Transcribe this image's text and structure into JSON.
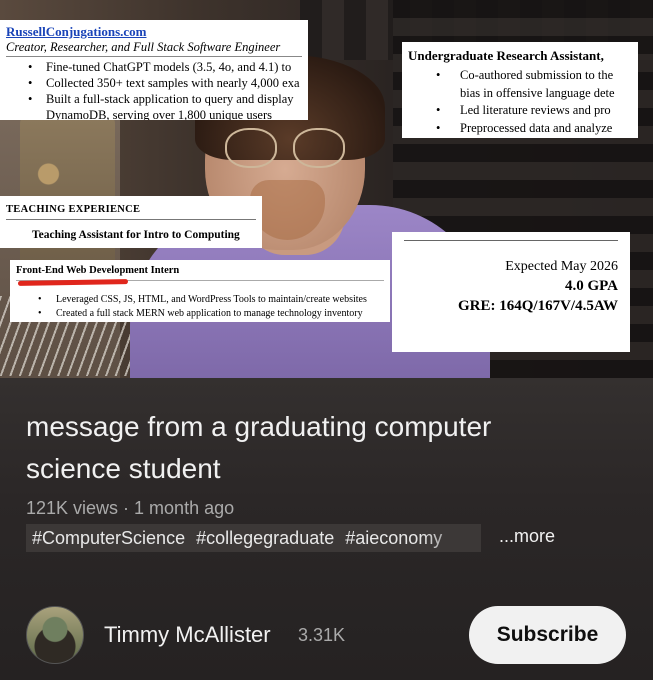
{
  "video": {
    "card_top_left": {
      "link": "RussellConjugations.com",
      "role": "Creator, Researcher, and Full Stack Software Engineer",
      "bullets": [
        "Fine-tuned ChatGPT models (3.5, 4o, and 4.1) to",
        "Collected 350+ text samples with nearly 4,000 exa",
        "Built a full-stack application to query and display"
      ],
      "continuation": "DynamoDB, serving over 1,800 unique users"
    },
    "card_top_right": {
      "heading": "Undergraduate Research Assistant,",
      "bullets": [
        "Co-authored submission to the",
        "Led literature reviews and pro",
        "Preprocessed data and analyze"
      ],
      "continuation": "bias in offensive language dete"
    },
    "card_teaching": {
      "label": "Teaching Experience",
      "position": "Teaching Assistant for Intro to Computing"
    },
    "card_intern": {
      "heading": "Front-End Web Development Intern",
      "bullets": [
        "Leveraged CSS, JS, HTML, and WordPress Tools to maintain/create websites",
        "Created a full stack MERN web application to manage technology inventory"
      ]
    },
    "card_education": {
      "expected": "Expected May 2026",
      "gpa": "4.0 GPA",
      "gre": "GRE: 164Q/167V/4.5AW"
    }
  },
  "info": {
    "title": "message from a graduating computer science student",
    "views": "121K views",
    "separator": "·",
    "age": "1 month ago",
    "meta_line": "121K views · 1 month ago",
    "hashtags": [
      "#ComputerScience",
      "#collegegraduate",
      "#aieconomy"
    ],
    "more_label": "...more"
  },
  "channel": {
    "name": "Timmy McAllister",
    "subscribers": "3.31K",
    "subscribe_label": "Subscribe"
  }
}
